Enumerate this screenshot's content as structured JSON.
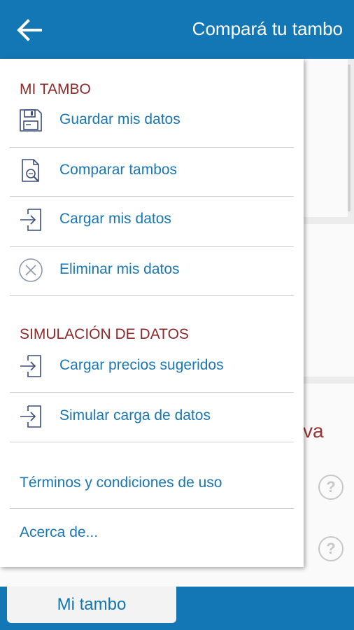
{
  "header": {
    "title": "Compará tu tambo",
    "back_icon": "arrow-left-icon"
  },
  "menu": {
    "section1": "MI TAMBO",
    "items1": [
      {
        "label": "Guardar mis datos",
        "icon": "floppy-disk-icon"
      },
      {
        "label": "Comparar tambos",
        "icon": "document-search-icon"
      },
      {
        "label": "Cargar mis datos",
        "icon": "sign-in-icon"
      },
      {
        "label": "Eliminar mis datos",
        "icon": "circle-x-icon"
      }
    ],
    "section2": "SIMULACIÓN DE DATOS",
    "items2": [
      {
        "label": "Cargar precios sugeridos",
        "icon": "sign-in-icon"
      },
      {
        "label": "Simular carga de datos",
        "icon": "sign-in-icon"
      }
    ],
    "terms": "Términos y condiciones de uso",
    "about": "Acerca de..."
  },
  "background": {
    "partial_text": "va",
    "help_glyph": "?"
  },
  "bottom_tab": {
    "label": "Mi tambo"
  },
  "colors": {
    "primary": "#1277b4",
    "section": "#8e2a2a",
    "link": "#1b77b3"
  }
}
